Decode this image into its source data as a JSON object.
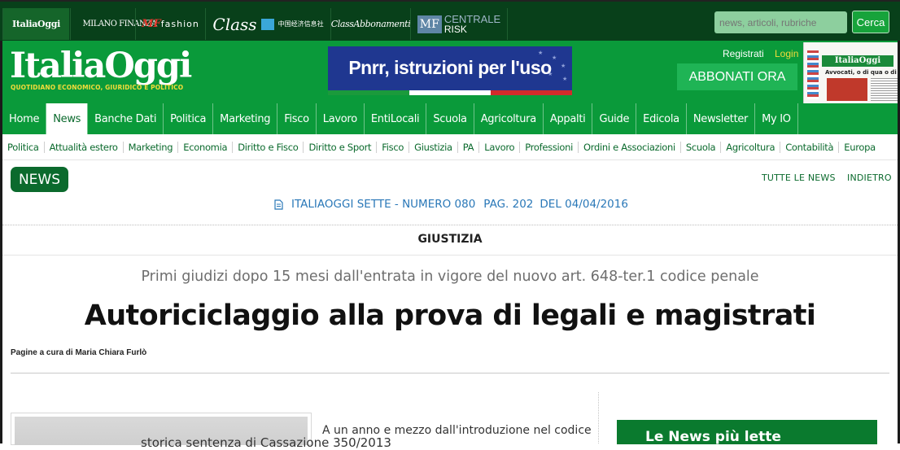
{
  "network_bar": {
    "tabs": [
      {
        "label": "ItaliaOggi"
      },
      {
        "label": "MILANO FINANZA"
      },
      {
        "label_mf": "MF",
        "label_rest": "fashion"
      },
      {
        "label": "Class",
        "sub_cn": "中国经济信息社"
      },
      {
        "label": "ClassAbbonamenti"
      },
      {
        "label_box": "MF",
        "label_top": "CENTRALE",
        "label_bottom": "RISK"
      }
    ],
    "search_placeholder": "news, articoli, rubriche",
    "search_button": "Cerca"
  },
  "masthead": {
    "logo": "ItaliaOggi",
    "tagline": "QUOTIDIANO ECONOMICO, GIURIDICO E POLITICO",
    "banner_text": "Pnrr, istruzioni per l'uso",
    "register": "Registrati",
    "login": "Login",
    "subscribe": "ABBONATI ORA",
    "front_page": {
      "logo": "ItaliaOggi",
      "headline": "Avvocati, o di qua o di là"
    }
  },
  "main_nav": [
    "Home",
    "News",
    "Banche Dati",
    "Politica",
    "Marketing",
    "Fisco",
    "Lavoro",
    "EntiLocali",
    "Scuola",
    "Agricoltura",
    "Appalti",
    "Guide",
    "Edicola",
    "Newsletter",
    "My IO"
  ],
  "main_nav_active": "News",
  "sub_nav": [
    "Politica",
    "Attualità estero",
    "Marketing",
    "Economia",
    "Diritto e Fisco",
    "Diritto e Sport",
    "Fisco",
    "Giustizia",
    "PA",
    "Lavoro",
    "Professioni",
    "Ordini e Associazioni",
    "Scuola",
    "Agricoltura",
    "Contabilità",
    "Europa"
  ],
  "content": {
    "badge": "NEWS",
    "all_news": "TUTTE LE NEWS",
    "back": "INDIETRO",
    "issue": {
      "source": "ITALIAOGGI SETTE - NUMERO 080",
      "page": "PAG. 202",
      "date": "DEL 04/04/2016"
    },
    "section": "GIUSTIZIA",
    "subtitle": "Primi giudizi dopo 15 mesi dall'entrata in vigore del nuovo art. 648-ter.1 codice penale",
    "headline": "Autoriciclaggio alla prova di legali e magistrati",
    "byline": "Pagine a cura di Maria Chiara Furlò",
    "caption": "storica sentenza di Cassazione 350/2013",
    "article_start": "A un anno e mezzo dall'introduzione nel codice",
    "sidebar_title": "Le News più lette"
  },
  "colors": {
    "dark_green": "#08401a",
    "brand_green": "#0a9a3a",
    "badge_green": "#0b6a2d",
    "yellow": "#f2dc3a",
    "link_blue": "#2a78b8",
    "banner_blue": "#1f3790"
  }
}
